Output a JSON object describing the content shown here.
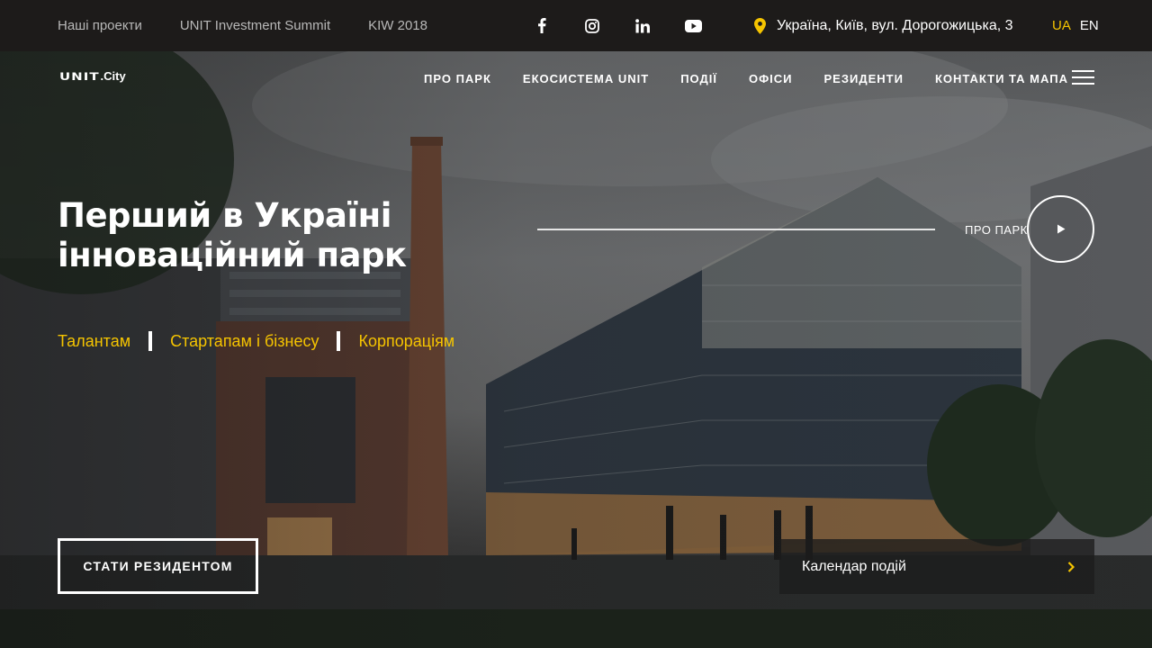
{
  "topbar": {
    "links": [
      "Наші проекти",
      "UNIT Investment Summit",
      "KIW 2018"
    ],
    "social": [
      "facebook-icon",
      "instagram-icon",
      "linkedin-icon",
      "youtube-icon"
    ],
    "address": "Україна, Київ, вул. Дорогожицька, 3",
    "lang_active": "UA",
    "lang_other": "EN"
  },
  "logo": {
    "main": "UNIT",
    "suffix": ".City"
  },
  "nav": [
    "ПРО ПАРК",
    "ЕКОСИСТЕМА UNIT",
    "ПОДІЇ",
    "ОФІСИ",
    "РЕЗИДЕНТИ",
    "КОНТАКТИ ТА МАПА"
  ],
  "hero": {
    "title_line1": "Перший в Україні",
    "title_line2": "інноваційний парк",
    "audience": [
      "Талантам",
      "Стартапам і бізнесу",
      "Корпораціям"
    ],
    "about_label": "ПРО ПАРК",
    "cta_label": "СТАТИ РЕЗИДЕНТОМ",
    "events_label": "Календар подій"
  },
  "colors": {
    "accent": "#f5c400",
    "topbar_bg": "#1d1b1a"
  }
}
